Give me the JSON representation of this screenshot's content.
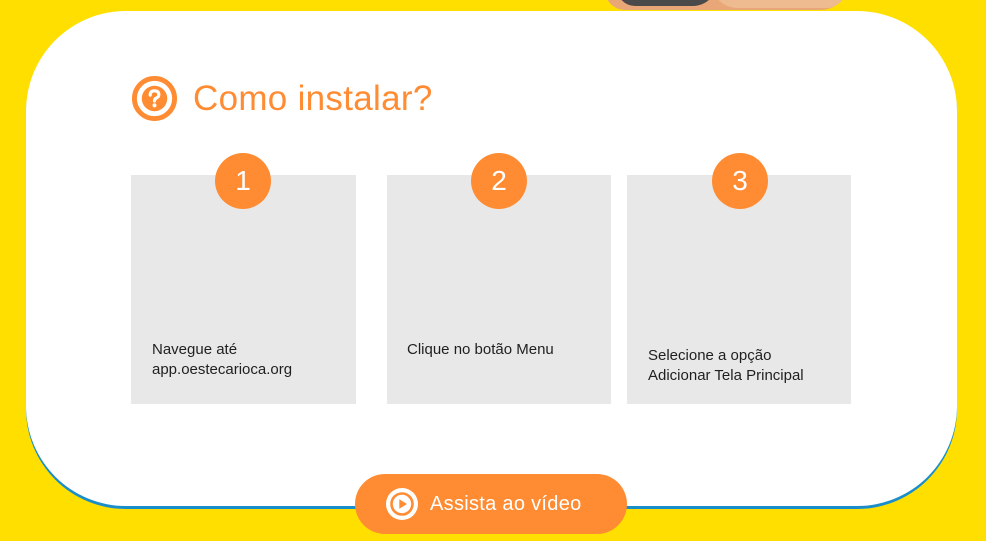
{
  "header": {
    "title": "Como instalar?",
    "icon": "question-circle-icon"
  },
  "steps": [
    {
      "number": "1",
      "text": "Navegue até\napp.oestecarioca.org"
    },
    {
      "number": "2",
      "text": "Clique no botão Menu"
    },
    {
      "number": "3",
      "text": "Selecione a opção\nAdicionar Tela Principal"
    }
  ],
  "video_button": {
    "label": "Assista ao vídeo",
    "icon": "play-circle-icon"
  },
  "colors": {
    "background": "#ffdf00",
    "accent": "#ff8c33",
    "card": "#ffffff",
    "card_border": "#1a8ecb",
    "step_panel": "#e8e8e8"
  }
}
